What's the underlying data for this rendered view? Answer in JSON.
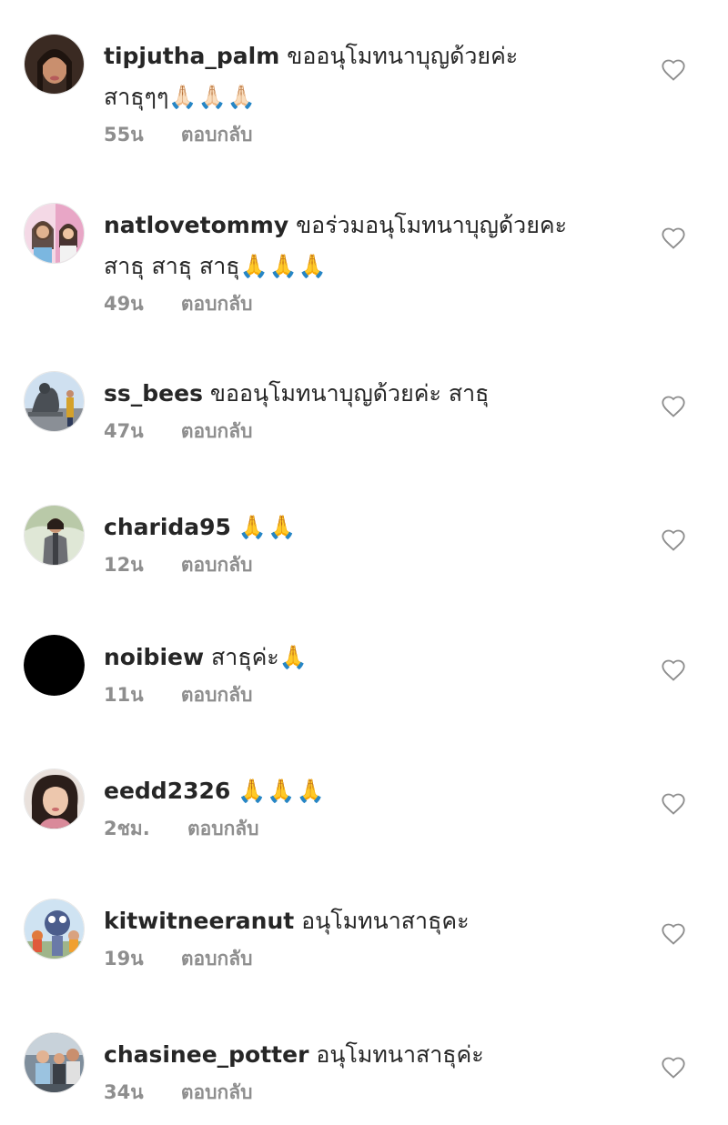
{
  "comments": [
    {
      "username": "tipjutha_palm",
      "line1": "ขออนุโมทนาบุญด้วยค่ะ",
      "line2": "สาธุๆๆ",
      "emoji": "🙏🏻🙏🏻🙏🏻",
      "time": "55น",
      "reply": "ตอบกลับ",
      "avatar": "avatar-woman-portrait"
    },
    {
      "username": "natlovetommy",
      "line1": "ขอร่วมอนุโมทนาบุญด้วยคะ",
      "line2": "สาธุ สาธุ สาธุ",
      "emoji": "🙏🙏🙏",
      "time": "49น",
      "reply": "ตอบกลับ",
      "avatar": "avatar-two-girls"
    },
    {
      "username": "ss_bees",
      "line1": "ขออนุโมทนาบุญด้วยค่ะ สาธุ",
      "line2": "",
      "emoji": "",
      "time": "47น",
      "reply": "ตอบกลับ",
      "avatar": "avatar-buddha-statue"
    },
    {
      "username": "charida95",
      "line1": "",
      "line2": "",
      "emoji": "🙏🙏",
      "time": "12น",
      "reply": "ตอบกลับ",
      "avatar": "avatar-woman-outdoor"
    },
    {
      "username": "noibiew",
      "line1": "สาธุค่ะ",
      "line2": "",
      "emoji": "🙏",
      "time": "11น",
      "reply": "ตอบกลับ",
      "avatar": "avatar-black"
    },
    {
      "username": "eedd2326",
      "line1": "",
      "line2": "",
      "emoji": "🙏🙏🙏",
      "time": "2ชม.",
      "reply": "ตอบกลับ",
      "avatar": "avatar-woman-selfie"
    },
    {
      "username": "kitwitneeranut",
      "line1": "อนุโมทนาสาธุคะ",
      "line2": "",
      "emoji": "",
      "time": "19น",
      "reply": "ตอบกลับ",
      "avatar": "avatar-kids-cartoon"
    },
    {
      "username": "chasinee_potter",
      "line1": "อนุโมทนาสาธุค่ะ",
      "line2": "",
      "emoji": "",
      "time": "34น",
      "reply": "ตอบกลับ",
      "avatar": "avatar-family"
    }
  ],
  "icons": {
    "like": "heart-outline-icon"
  },
  "colors": {
    "username": "#262626",
    "meta": "#8e8e8e",
    "heart": "#8e8e8e"
  }
}
